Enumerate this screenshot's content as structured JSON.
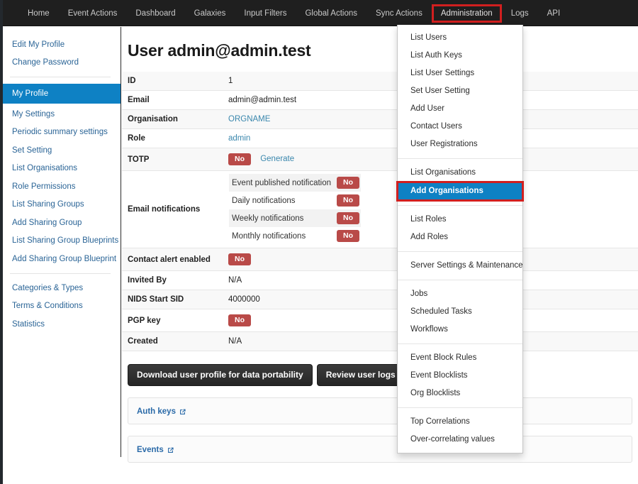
{
  "navbar": {
    "items": [
      {
        "label": "Home",
        "highlighted": false
      },
      {
        "label": "Event Actions",
        "highlighted": false
      },
      {
        "label": "Dashboard",
        "highlighted": false
      },
      {
        "label": "Galaxies",
        "highlighted": false
      },
      {
        "label": "Input Filters",
        "highlighted": false
      },
      {
        "label": "Global Actions",
        "highlighted": false
      },
      {
        "label": "Sync Actions",
        "highlighted": false
      },
      {
        "label": "Administration",
        "highlighted": true
      },
      {
        "label": "Logs",
        "highlighted": false
      },
      {
        "label": "API",
        "highlighted": false
      }
    ]
  },
  "sidebar": {
    "groups": [
      {
        "items": [
          {
            "label": "Edit My Profile",
            "active": false
          },
          {
            "label": "Change Password",
            "active": false
          }
        ]
      },
      {
        "items": [
          {
            "label": "My Profile",
            "active": true
          },
          {
            "label": "My Settings",
            "active": false
          },
          {
            "label": "Periodic summary settings",
            "active": false
          },
          {
            "label": "Set Setting",
            "active": false
          },
          {
            "label": "List Organisations",
            "active": false
          },
          {
            "label": "Role Permissions",
            "active": false
          },
          {
            "label": "List Sharing Groups",
            "active": false
          },
          {
            "label": "Add Sharing Group",
            "active": false
          },
          {
            "label": "List Sharing Group Blueprints",
            "active": false
          },
          {
            "label": "Add Sharing Group Blueprint",
            "active": false
          }
        ]
      },
      {
        "items": [
          {
            "label": "Categories & Types",
            "active": false
          },
          {
            "label": "Terms & Conditions",
            "active": false
          },
          {
            "label": "Statistics",
            "active": false
          }
        ]
      }
    ]
  },
  "main": {
    "title": "User admin@admin.test",
    "rows": {
      "id_key": "ID",
      "id_value": "1",
      "email_key": "Email",
      "email_value": "admin@admin.test",
      "org_key": "Organisation",
      "org_value": "ORGNAME",
      "role_key": "Role",
      "role_value": "admin",
      "totp_key": "TOTP",
      "totp_value": "No",
      "totp_generate_label": "Generate",
      "email_notifications_key": "Email notifications",
      "contact_alert_key": "Contact alert enabled",
      "contact_alert_value": "No",
      "invited_by_key": "Invited By",
      "invited_by_value": "N/A",
      "nids_key": "NIDS Start SID",
      "nids_value": "4000000",
      "pgp_key": "PGP key",
      "pgp_value": "No",
      "created_key": "Created",
      "created_value": "N/A"
    },
    "notifications": [
      {
        "label": "Event published notification",
        "value": "No"
      },
      {
        "label": "Daily notifications",
        "value": "No"
      },
      {
        "label": "Weekly notifications",
        "value": "No"
      },
      {
        "label": "Monthly notifications",
        "value": "No"
      }
    ],
    "buttons": {
      "download_label": "Download user profile for data portability",
      "review_logs_label": "Review user logs"
    },
    "panels": [
      {
        "label": "Auth keys"
      },
      {
        "label": "Events"
      }
    ]
  },
  "dropdown": {
    "sections": [
      {
        "items": [
          {
            "label": "List Users",
            "selected": false
          },
          {
            "label": "List Auth Keys",
            "selected": false
          },
          {
            "label": "List User Settings",
            "selected": false
          },
          {
            "label": "Set User Setting",
            "selected": false
          },
          {
            "label": "Add User",
            "selected": false
          },
          {
            "label": "Contact Users",
            "selected": false
          },
          {
            "label": "User Registrations",
            "selected": false
          }
        ]
      },
      {
        "items": [
          {
            "label": "List Organisations",
            "selected": false
          },
          {
            "label": "Add Organisations",
            "selected": true
          }
        ]
      },
      {
        "items": [
          {
            "label": "List Roles",
            "selected": false
          },
          {
            "label": "Add Roles",
            "selected": false
          }
        ]
      },
      {
        "items": [
          {
            "label": "Server Settings & Maintenance",
            "selected": false
          }
        ]
      },
      {
        "items": [
          {
            "label": "Jobs",
            "selected": false
          },
          {
            "label": "Scheduled Tasks",
            "selected": false
          },
          {
            "label": "Workflows",
            "selected": false
          }
        ]
      },
      {
        "items": [
          {
            "label": "Event Block Rules",
            "selected": false
          },
          {
            "label": "Event Blocklists",
            "selected": false
          },
          {
            "label": "Org Blocklists",
            "selected": false
          }
        ]
      },
      {
        "items": [
          {
            "label": "Top Correlations",
            "selected": false
          },
          {
            "label": "Over-correlating values",
            "selected": false
          }
        ]
      }
    ]
  },
  "colors": {
    "navbar_bg": "#1f1f1f",
    "accent_blue": "#0e81c4",
    "link_blue": "#3a87ad",
    "highlight_red": "#d11f1f",
    "badge_red": "#b94a48"
  }
}
